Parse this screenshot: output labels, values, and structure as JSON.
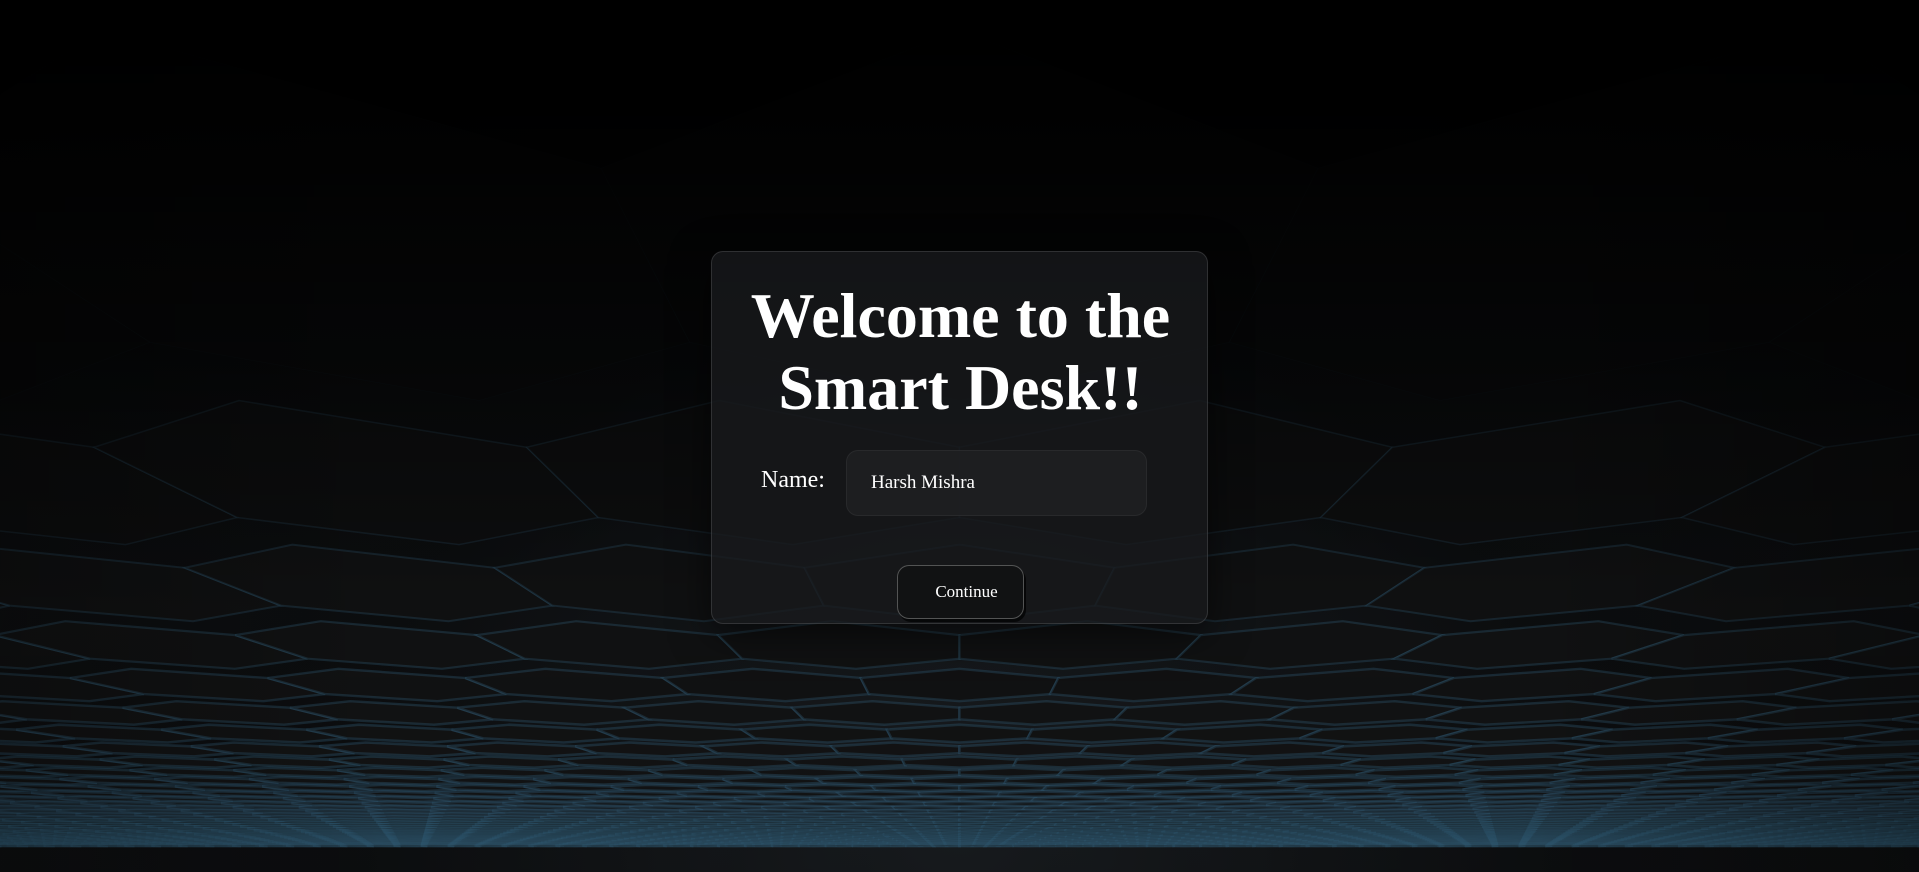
{
  "welcome": {
    "title_line1": "Welcome to the",
    "title_line2": "Smart Desk!!"
  },
  "form": {
    "name_label": "Name:",
    "name_value": "Harsh Mishra",
    "continue_label": "Continue"
  },
  "colors": {
    "background": "#000000",
    "card": "#1a1c1e",
    "text": "#ffffff",
    "hex_edge_glow": "#3b6f8f"
  }
}
